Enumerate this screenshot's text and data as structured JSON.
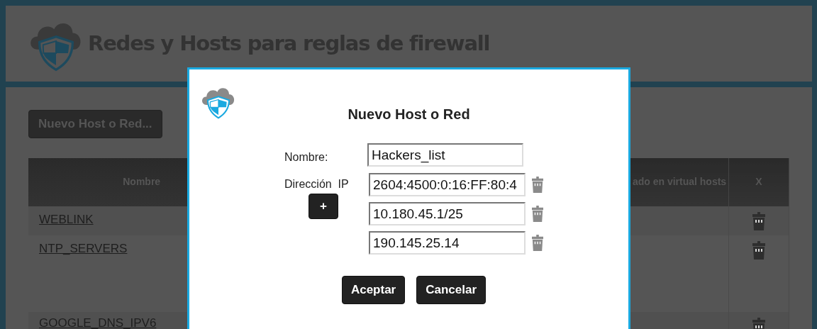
{
  "header": {
    "title": "Redes y Hosts para reglas de firewall"
  },
  "toolbar": {
    "new_button": "Nuevo Host o Red..."
  },
  "table": {
    "columns": [
      "Nombre",
      "ado en virtual hosts",
      "X"
    ],
    "rows": [
      {
        "name": "WEBLINK"
      },
      {
        "name": "NTP_SERVERS"
      },
      {
        "name": "GOOGLE_DNS_IPV6"
      }
    ]
  },
  "dialog": {
    "title": "Nuevo Host o Red",
    "name_label": "Nombre:",
    "name_value": "Hackers_list",
    "ip_label": "Dirección  IP",
    "add_button": "+",
    "ip_addresses": [
      "2604:4500:0:16:FF:80:4",
      "10.180.45.1/25",
      "190.145.25.14"
    ],
    "buttons": [
      "Aceptar",
      "Cancelar"
    ]
  }
}
